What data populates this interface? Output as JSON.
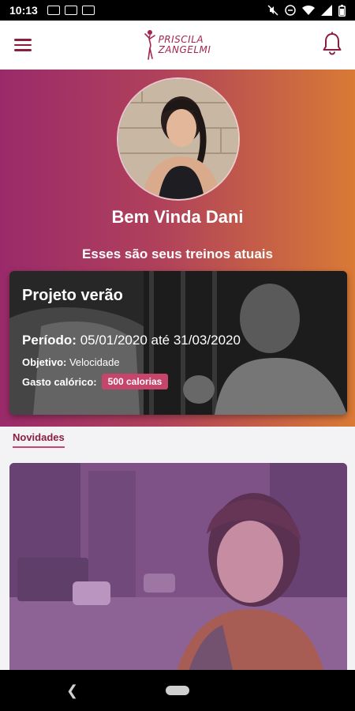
{
  "status_bar": {
    "time": "10:13"
  },
  "header": {
    "logo_line1": "PRISCILA",
    "logo_line2": "ZANGELMI",
    "menu_icon": "hamburger-menu-icon",
    "bell_icon": "bell-icon"
  },
  "hero": {
    "welcome": "Bem Vinda Dani",
    "subtitle": "Esses são seus treinos atuais"
  },
  "workout": {
    "title": "Projeto verão",
    "period_label": "Período:",
    "period_value": "05/01/2020 até 31/03/2020",
    "goal_label": "Objetivo:",
    "goal_value": "Velocidade",
    "calories_label": "Gasto calórico:",
    "calories_value": "500 calorias"
  },
  "news": {
    "label": "Novidades"
  },
  "colors": {
    "brand": "#8b1e3f",
    "gradient_start": "#9a2a6a",
    "gradient_end": "#d97a35",
    "badge": "#c5456b"
  }
}
